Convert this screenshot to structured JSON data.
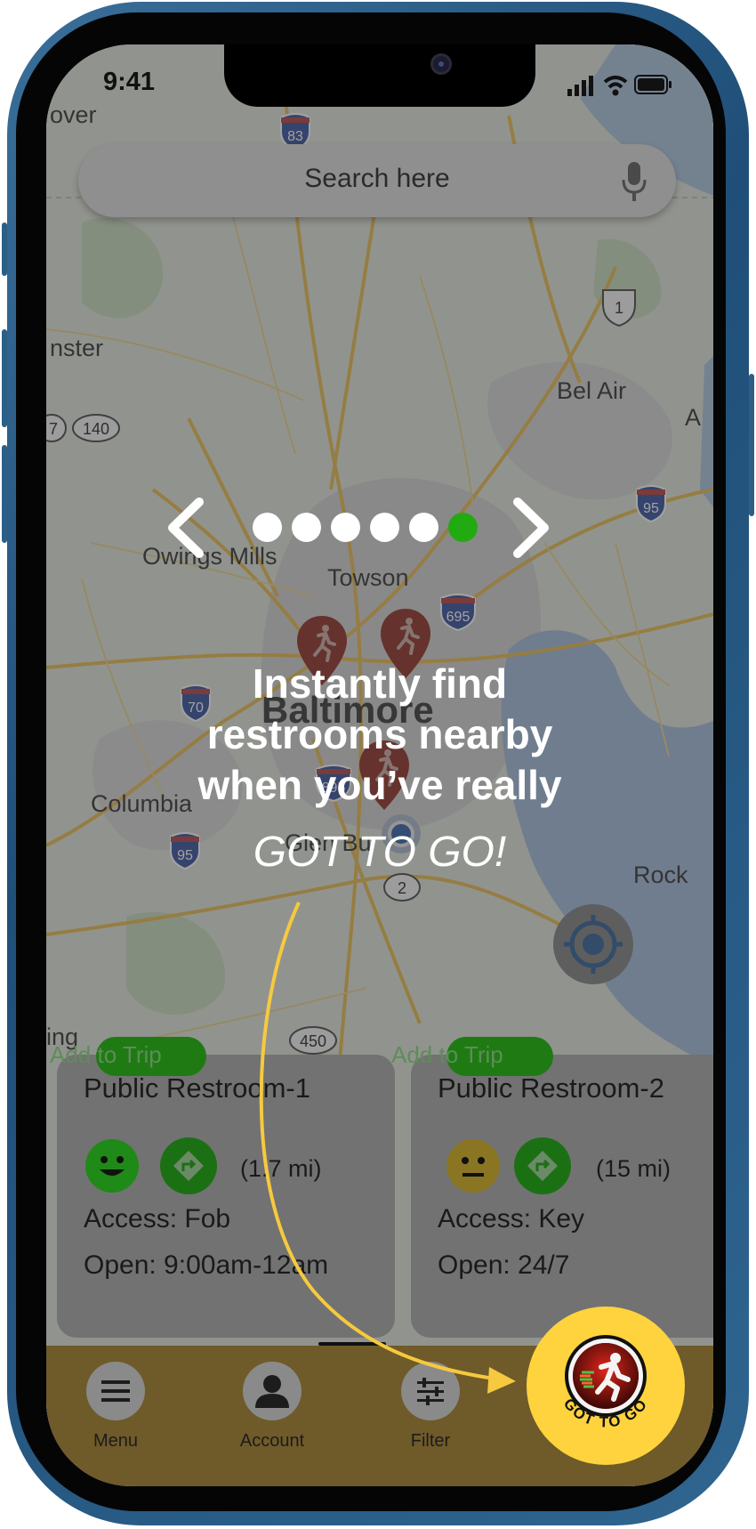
{
  "status_bar": {
    "time": "9:41"
  },
  "search": {
    "placeholder": "Search here"
  },
  "map": {
    "labels": [
      "over",
      "nster",
      "Bel Air",
      "A",
      "Owings Mills",
      "Towson",
      "Baltimore",
      "Columbia",
      "Rock",
      "Glen Bu",
      "ing"
    ],
    "route_shields": [
      "83",
      "1",
      "140",
      "95",
      "695",
      "70",
      "895",
      "95",
      "2",
      "450",
      "7"
    ]
  },
  "onboarding": {
    "current_page": 6,
    "total_pages": 6,
    "headline_lines": [
      "Instantly find",
      "restrooms nearby",
      "when you’ve really"
    ],
    "emphasis": "GOT TO GO!"
  },
  "cards": [
    {
      "badge": "Add to Trip",
      "title": "Public Restroom-1",
      "rating_icon": "happy-face-icon",
      "rating_color": "#1f8a17",
      "distance": "(1.7 mi)",
      "access": "Access: Fob",
      "hours": "Open: 9:00am-12am"
    },
    {
      "badge": "Add to Trip",
      "title": "Public Restroom-2",
      "rating_icon": "neutral-face-icon",
      "rating_color": "#8a7522",
      "distance": "(15 mi)",
      "access": "Access: Key",
      "hours": "Open: 24/7"
    }
  ],
  "bottom_nav": {
    "items": [
      {
        "label": "Menu",
        "icon": "hamburger-icon"
      },
      {
        "label": "Account",
        "icon": "person-icon"
      },
      {
        "label": "Filter",
        "icon": "sliders-icon"
      }
    ],
    "primary_action": {
      "label": "GOT TO GO",
      "icon": "running-man-icon"
    }
  },
  "colors": {
    "accent_yellow": "#ffd33d",
    "pin_red": "#8b2a20",
    "active_dot": "#22aa11",
    "card_green": "#1f7a14"
  }
}
